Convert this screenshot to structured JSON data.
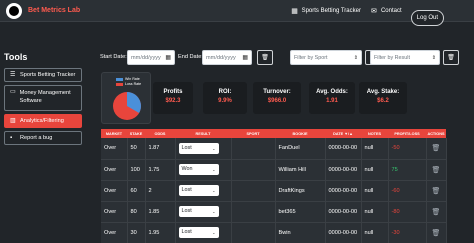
{
  "navbar": {
    "brand": "Bet Metrics Lab",
    "links": [
      {
        "label": "Sports Betting Tracker",
        "icon": "grid-icon"
      },
      {
        "label": "Contact",
        "icon": "mail-icon"
      }
    ],
    "logout_label": "Log Out"
  },
  "sidebar": {
    "title": "Tools",
    "items": [
      {
        "label": "Sports Betting Tracker",
        "icon": "list-icon",
        "active": false
      },
      {
        "label": "Money Management Software",
        "icon": "money-icon",
        "active": false
      },
      {
        "label": "Analytics/Filtering",
        "icon": "chart-icon",
        "active": true
      },
      {
        "label": "Report a bug",
        "icon": "chat-icon",
        "active": false
      }
    ]
  },
  "filters": {
    "start_label": "Start Date:",
    "start_placeholder": "mm/dd/yyyy",
    "end_label": "End Date:",
    "end_placeholder": "mm/dd/yyyy",
    "sport_placeholder": "Filter by Sport",
    "result_placeholder": "Filter by Result"
  },
  "chart_data": {
    "type": "pie",
    "legend": [
      "Win Rate",
      "Loss Rate"
    ],
    "colors": [
      "#4a90d9",
      "#e8453c"
    ]
  },
  "stats": [
    {
      "label": "Profits",
      "value": "$92.3"
    },
    {
      "label": "ROI:",
      "value": "9.9%"
    },
    {
      "label": "Turnover:",
      "value": "$966.0"
    },
    {
      "label": "Avg. Odds:",
      "value": "1.91"
    },
    {
      "label": "Avg. Stake:",
      "value": "$6.2"
    }
  ],
  "table": {
    "headers": [
      "Market",
      "Stake",
      "Odds",
      "Result",
      "Sport",
      "Bookie",
      "Date ▼/▲",
      "Notes",
      "Profit/Loss",
      "Actions"
    ],
    "rows": [
      {
        "market": "Over",
        "stake": "50",
        "odds": "1.87",
        "result": "Lost",
        "sport": "",
        "bookie": "FanDuel",
        "date": "0000-00-00",
        "notes": "null",
        "pl": "-50",
        "pl_sign": "neg"
      },
      {
        "market": "Over",
        "stake": "100",
        "odds": "1.75",
        "result": "Won",
        "sport": "",
        "bookie": "William Hill",
        "date": "0000-00-00",
        "notes": "null",
        "pl": "75",
        "pl_sign": "pos"
      },
      {
        "market": "Over",
        "stake": "60",
        "odds": "2",
        "result": "Lost",
        "sport": "",
        "bookie": "DraftKings",
        "date": "0000-00-00",
        "notes": "null",
        "pl": "-60",
        "pl_sign": "neg"
      },
      {
        "market": "Over",
        "stake": "80",
        "odds": "1.85",
        "result": "Lost",
        "sport": "",
        "bookie": "bet365",
        "date": "0000-00-00",
        "notes": "null",
        "pl": "-80",
        "pl_sign": "neg"
      },
      {
        "market": "Over",
        "stake": "30",
        "odds": "1.95",
        "result": "Lost",
        "sport": "",
        "bookie": "Bwin",
        "date": "0000-00-00",
        "notes": "null",
        "pl": "-30",
        "pl_sign": "neg"
      }
    ]
  }
}
